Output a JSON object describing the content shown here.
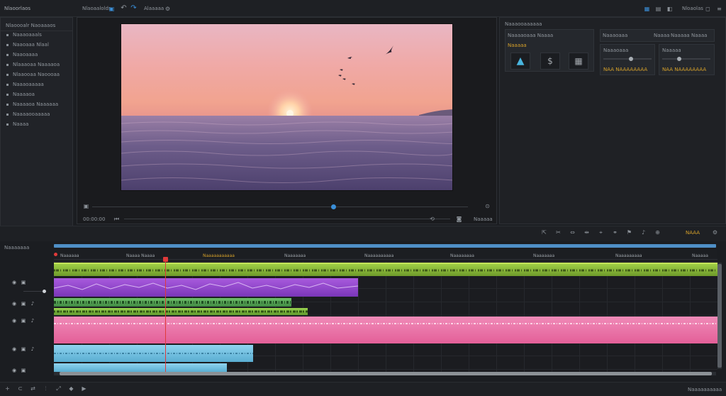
{
  "colors": {
    "accent": "#3a8fd9",
    "playhead": "#e03a3a",
    "clip_green": "#8fbf3a",
    "clip_purple": "#9a4fd6",
    "clip_pink": "#e86aa0",
    "clip_blue": "#7cc4e4",
    "text_gold": "#d6a12a"
  },
  "topbar": {
    "app_title": "Nlaoorlaos",
    "breadcrumb": "Nlaoaalolds",
    "tab_left": "Alaaaaa",
    "right_label": "Nloaolas"
  },
  "media": {
    "header": "Nlaoooalr  Naoaaaos",
    "items": [
      {
        "label": "Naaaoaaals"
      },
      {
        "label": "Naaoaaa Nlaal"
      },
      {
        "label": "Naaoaaaa"
      },
      {
        "label": "Nlaaaoaa Naaaaoa"
      },
      {
        "label": "Nlaaooaa Naoooaa"
      },
      {
        "label": "Naaaoaaaaa"
      },
      {
        "label": "Naaaaoa"
      },
      {
        "label": "Naaaaoa Naaaaaa"
      },
      {
        "label": "Naaaaooaaaaa"
      },
      {
        "label": "Naaaa"
      }
    ]
  },
  "viewer": {
    "timecode": "00:00:00",
    "zoom_label": "Naaaaa"
  },
  "inspector": {
    "header": "Naaaooaaaaaa",
    "section1_title": "Naaaaoaaa Naaaa",
    "section1_value": "Naaaaa",
    "section2_title": "Naaaoaaa",
    "section2_tabs": [
      "Naaaa",
      "Naaaaa",
      "Naaaa"
    ],
    "row1_label": "Naaaoaaa",
    "row2_label": "Naaaaa",
    "value_a": "NAA NAAAAAAAA",
    "value_b": "NAA NAAAAAAAA"
  },
  "timeline": {
    "header_label": "Naaaaaaa",
    "tools_right_badge": "NAAA",
    "ruler": [
      {
        "label": "Naaaaaa"
      },
      {
        "label": "Naaaa Naaaa"
      },
      {
        "label": "Naaaaaaaaaaa"
      },
      {
        "label": "Naaaaaaa"
      },
      {
        "label": "Naaaaaaaaaa"
      },
      {
        "label": "Naaaaaaaa"
      },
      {
        "label": "Naaaaaaa"
      },
      {
        "label": "Naaaaaaaaa"
      },
      {
        "label": "Naaaaa"
      }
    ],
    "footer_label": "Naaaaaaaaaa"
  }
}
